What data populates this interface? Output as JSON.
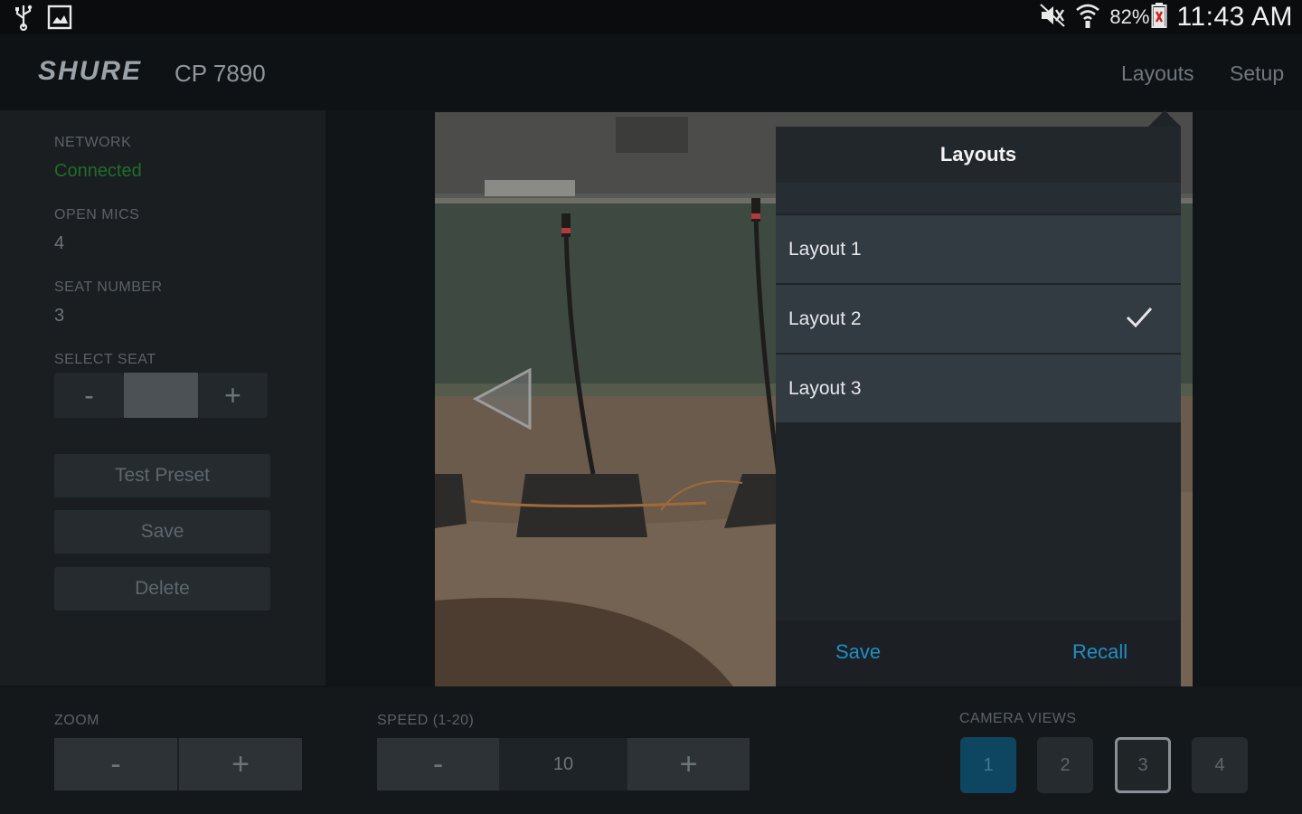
{
  "status_bar": {
    "battery_percent": "82%",
    "time": "11:43 AM"
  },
  "header": {
    "brand": "SHURE",
    "model": "CP 7890",
    "nav": {
      "layouts": "Layouts",
      "setup": "Setup"
    }
  },
  "info": {
    "network_label": "NETWORK",
    "network_value": "Connected",
    "open_mics_label": "OPEN MICS",
    "open_mics_value": "4",
    "seat_number_label": "SEAT NUMBER",
    "seat_number_value": "3",
    "select_seat_label": "SELECT SEAT",
    "minus": "-",
    "plus": "+"
  },
  "actions": {
    "test_preset": "Test Preset",
    "save": "Save",
    "delete": "Delete"
  },
  "layouts_popup": {
    "title": "Layouts",
    "items": [
      {
        "label": "Layout 1"
      },
      {
        "label": "Layout 2"
      },
      {
        "label": "Layout 3"
      }
    ],
    "selected_index": 1,
    "save": "Save",
    "recall": "Recall"
  },
  "bottom": {
    "zoom_label": "ZOOM",
    "speed_label": "SPEED (1-20)",
    "speed_value": "10",
    "camera_views_label": "CAMERA VIEWS",
    "minus": "-",
    "plus": "+",
    "camera_views": [
      "1",
      "2",
      "3",
      "4"
    ],
    "active_view": "1",
    "outlined_view": "3"
  },
  "colors": {
    "accent": "#1f8fc4",
    "connected": "#1f6d28",
    "active_view": "#0e4561"
  }
}
